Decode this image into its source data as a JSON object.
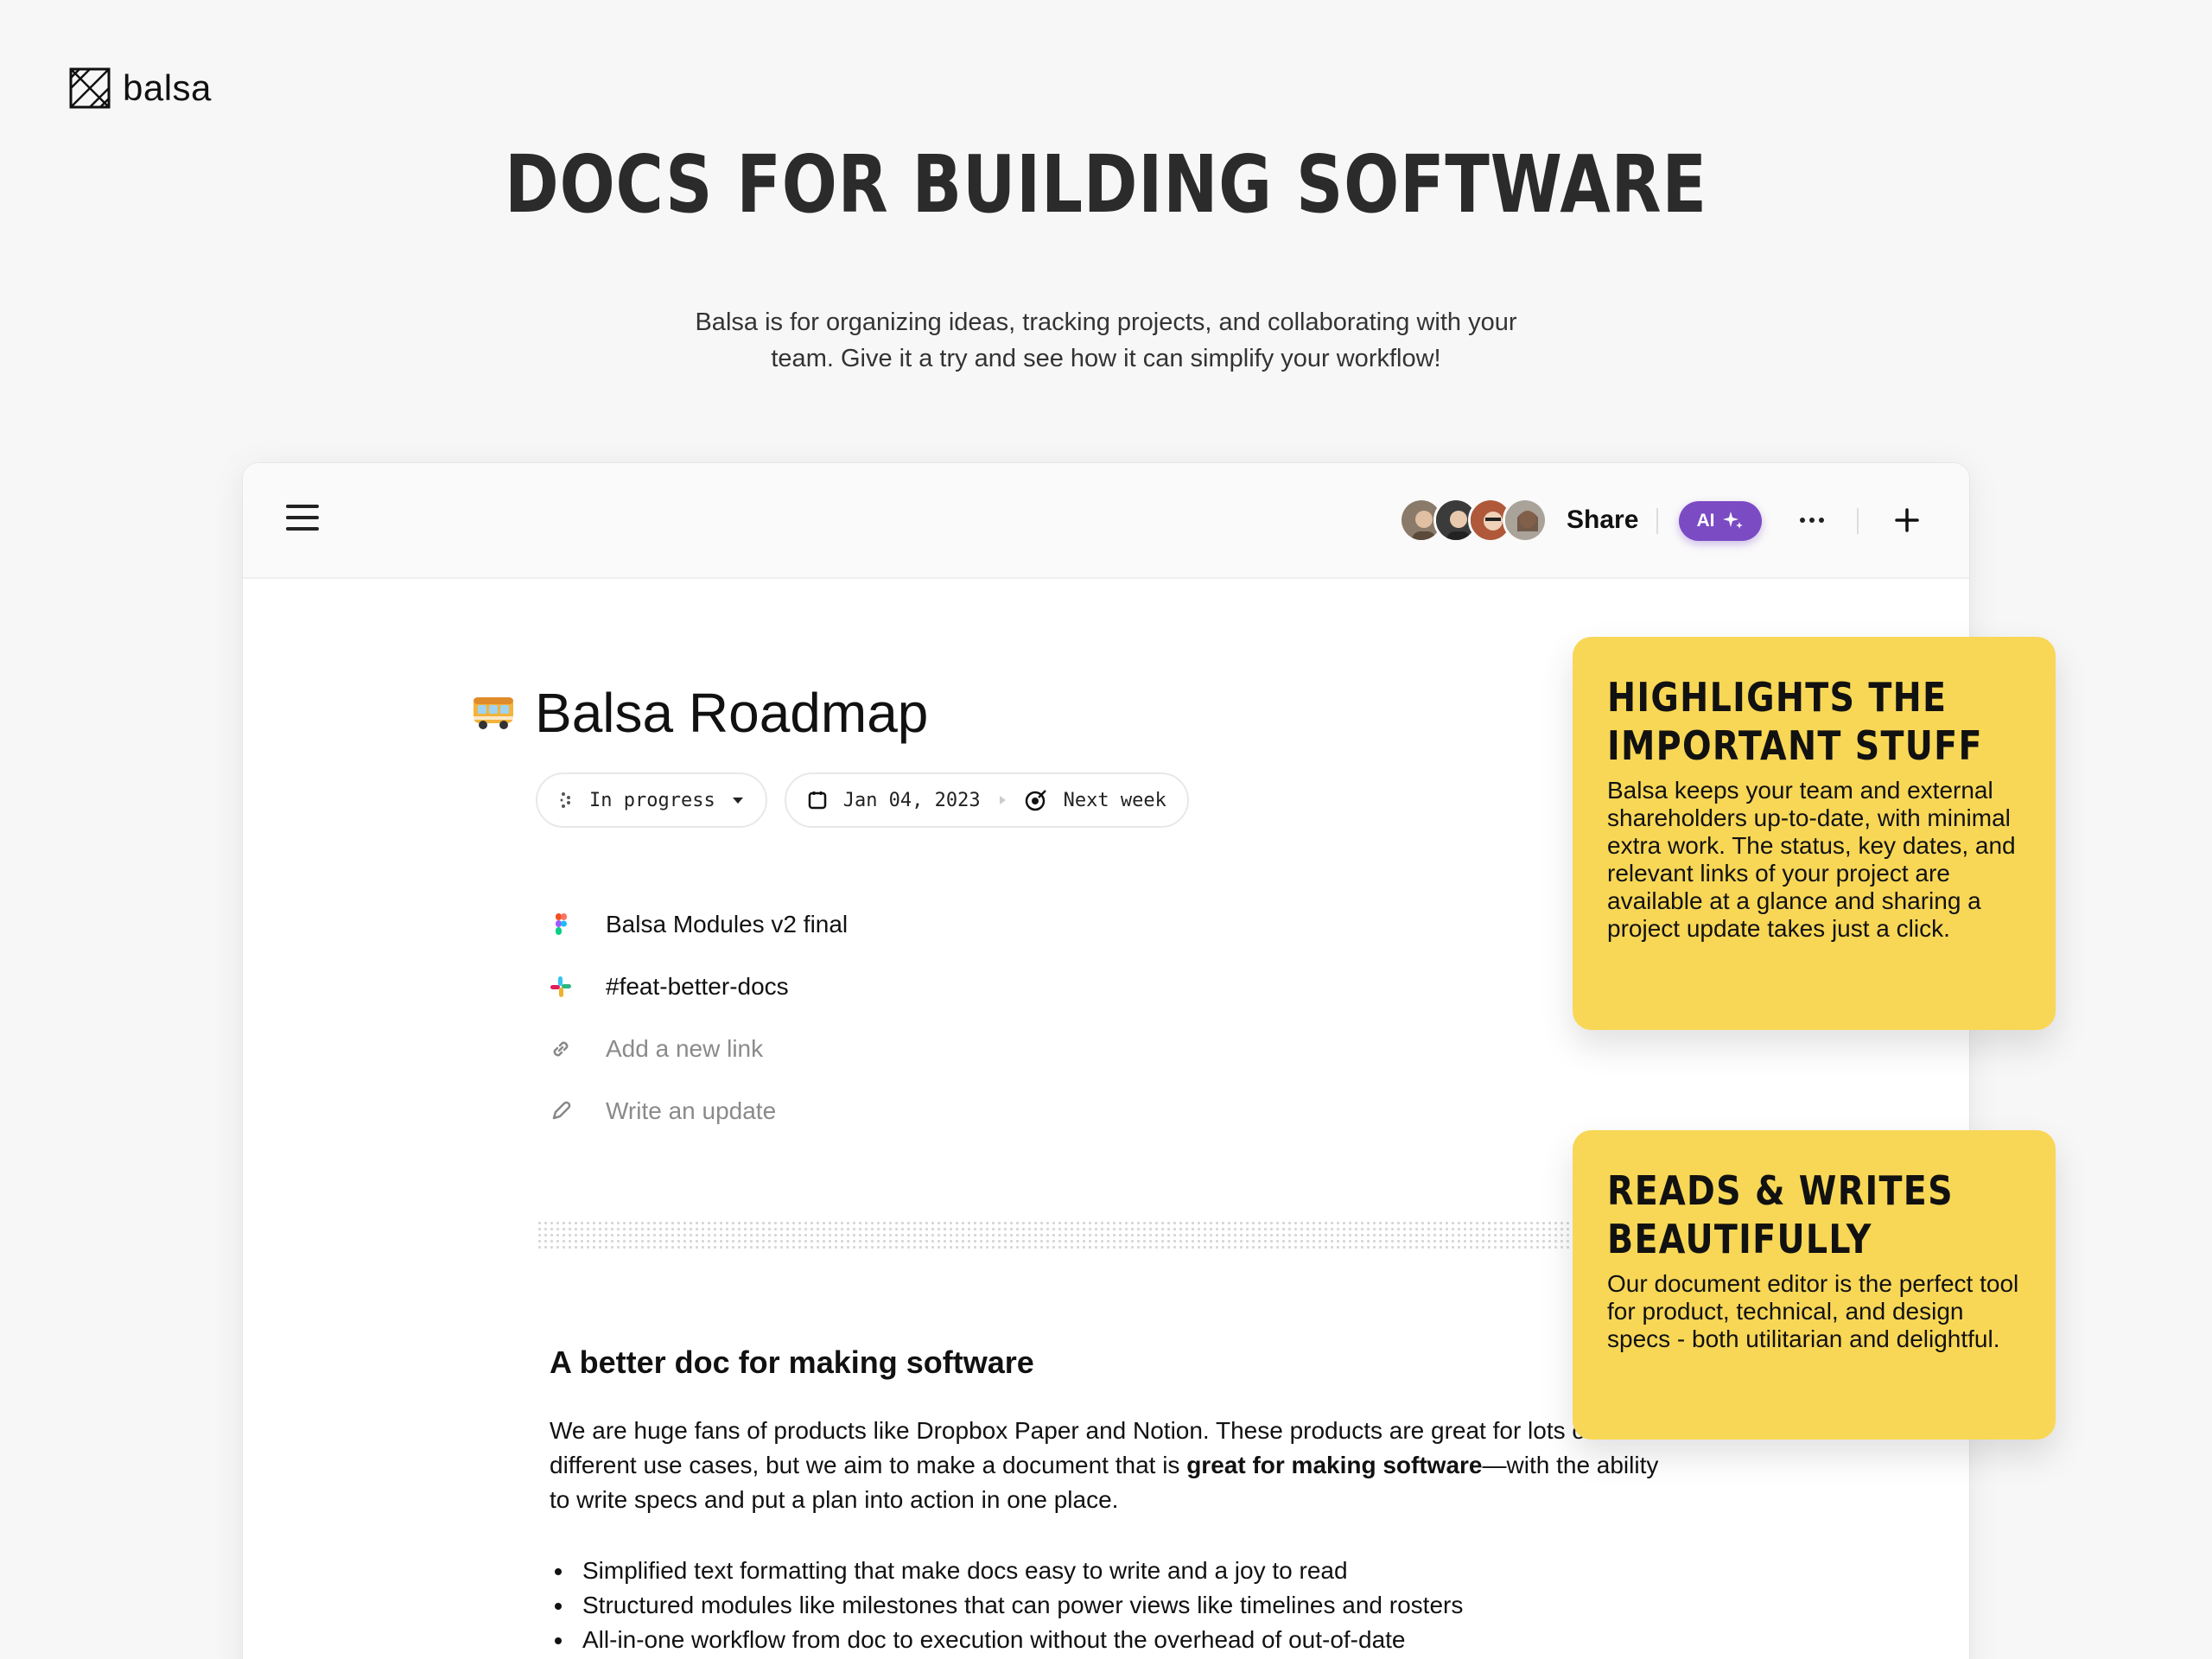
{
  "brand": {
    "name": "balsa"
  },
  "hero": {
    "headline": "DOCS FOR BUILDING SOFTWARE",
    "subtitle_line1": "Balsa is for organizing ideas, tracking projects, and collaborating with your",
    "subtitle_line2": "team. Give it a try and see how it can simplify your workflow!"
  },
  "toolbar": {
    "share_label": "Share",
    "ai_label": "AI"
  },
  "doc": {
    "title": "Balsa Roadmap",
    "status": "In progress",
    "start_date": "Jan 04, 2023",
    "due": "Next week",
    "links": [
      {
        "icon": "figma-icon",
        "label": "Balsa Modules v2 final"
      },
      {
        "icon": "slack-icon",
        "label": "#feat-better-docs"
      },
      {
        "icon": "link-icon",
        "label": "Add a new link"
      },
      {
        "icon": "pencil-icon",
        "label": "Write an update"
      }
    ],
    "section_title": "A better doc for making software",
    "para_part1": "We are huge fans of products like Dropbox Paper and Notion. These products are great for lots of different use cases, but we aim to make a document that is ",
    "para_bold": "great for making software",
    "para_part2": "—with the ability to write specs and put a plan into action in one place.",
    "bullets": [
      "Simplified text formatting that make docs easy to write and a joy to read",
      "Structured modules like milestones that can power views like timelines and rosters",
      "All-in-one workflow from doc to execution without the overhead of out-of-date"
    ]
  },
  "cards": [
    {
      "title_line1": "HIGHLIGHTS THE",
      "title_line2": "IMPORTANT STUFF",
      "body": "Balsa keeps your team and external shareholders up-to-date, with minimal extra work. The status, key dates, and relevant links of your project are available at a glance and sharing a project update takes just a click."
    },
    {
      "title_line1": "READS & WRITES",
      "title_line2": "BEAUTIFULLY",
      "body": "Our document editor is the perfect tool for product, technical, and design specs - both utilitarian and delightful."
    }
  ],
  "colors": {
    "accent_ai": "#7b4bc4",
    "card_yellow": "#f8d756",
    "background": "#f7f7f7"
  }
}
